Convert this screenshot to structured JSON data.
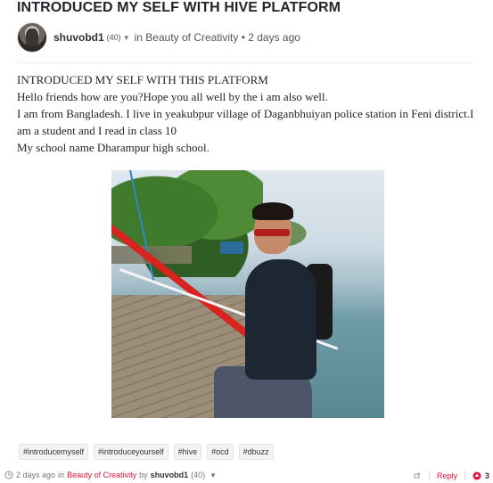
{
  "post": {
    "title": "INTRODUCED MY SELF WITH HIVE PLATFORM",
    "author": "shuvobd1",
    "reputation": "(40)",
    "in_label": "in",
    "community": "Beauty of Creativity",
    "separator": "•",
    "time_ago": "2 days ago",
    "body": [
      "INTRODUCED MY SELF WITH THIS PLATFORM",
      "Hello friends how are you?Hope you all well by the i am also well.",
      "I am from Bangladesh. I live in yeakubpur village of Daganbhuiyan police station in Feni district.I am a student and I read in class 10",
      "My school name Dharampur high school."
    ]
  },
  "tags": [
    "#introducemyself",
    "#introduceyourself",
    "#hive",
    "#ocd",
    "#dbuzz"
  ],
  "footer": {
    "time_ago": "2 days ago",
    "in_label": "in",
    "community": "Beauty of Creativity",
    "by_label": "by",
    "author": "shuvobd1",
    "reputation": "(40)",
    "reply_label": "Reply",
    "upvote_count": "3"
  },
  "colors": {
    "accent": "#e31337",
    "text": "#212529",
    "muted": "#777777"
  },
  "icons": {
    "caret": "chevron-down-icon",
    "clock": "clock-icon",
    "reblog": "reblog-icon",
    "upvote": "upvote-icon"
  }
}
